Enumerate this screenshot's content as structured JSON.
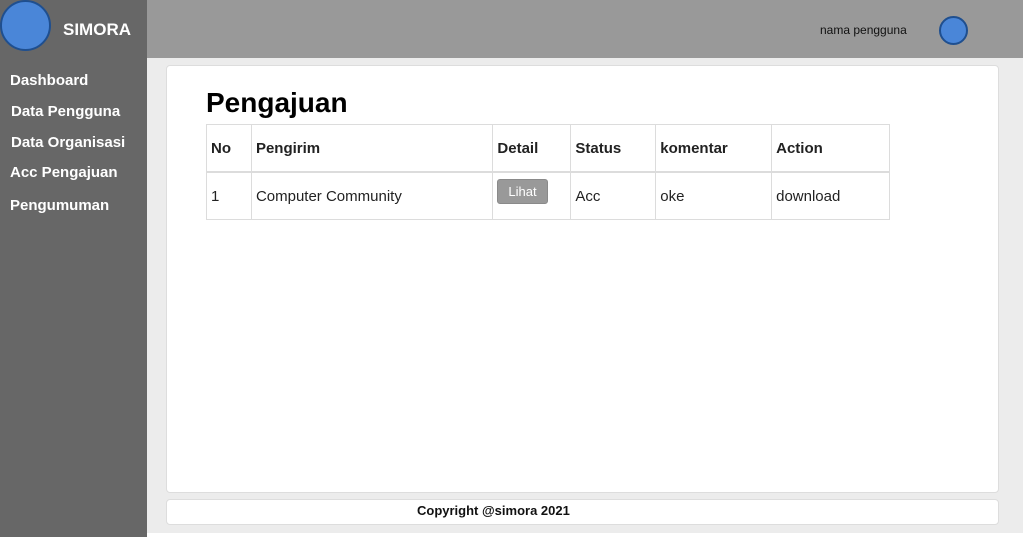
{
  "app": {
    "name": "SIMORA"
  },
  "sidebar": {
    "items": [
      {
        "label": "Dashboard"
      },
      {
        "label": "Data Pengguna"
      },
      {
        "label": "Data Organisasi"
      },
      {
        "label": "Acc Pengajuan"
      },
      {
        "label": "Pengumuman"
      }
    ]
  },
  "header": {
    "user_name": "nama pengguna"
  },
  "main": {
    "title": "Pengajuan",
    "table": {
      "columns": [
        "No",
        "Pengirim",
        "Detail",
        "Status",
        "komentar",
        "Action"
      ],
      "rows": [
        {
          "no": "1",
          "pengirim": "Computer Community",
          "detail": "Lihat",
          "status": "Acc",
          "komentar": "oke",
          "action": "download"
        }
      ]
    }
  },
  "footer": {
    "text": "Copyright @simora 2021"
  },
  "colors": {
    "sidebar": "#676767",
    "topbar": "#999999",
    "avatar": "#4a86d8",
    "content_bg": "#ececec",
    "button": "#999999"
  }
}
